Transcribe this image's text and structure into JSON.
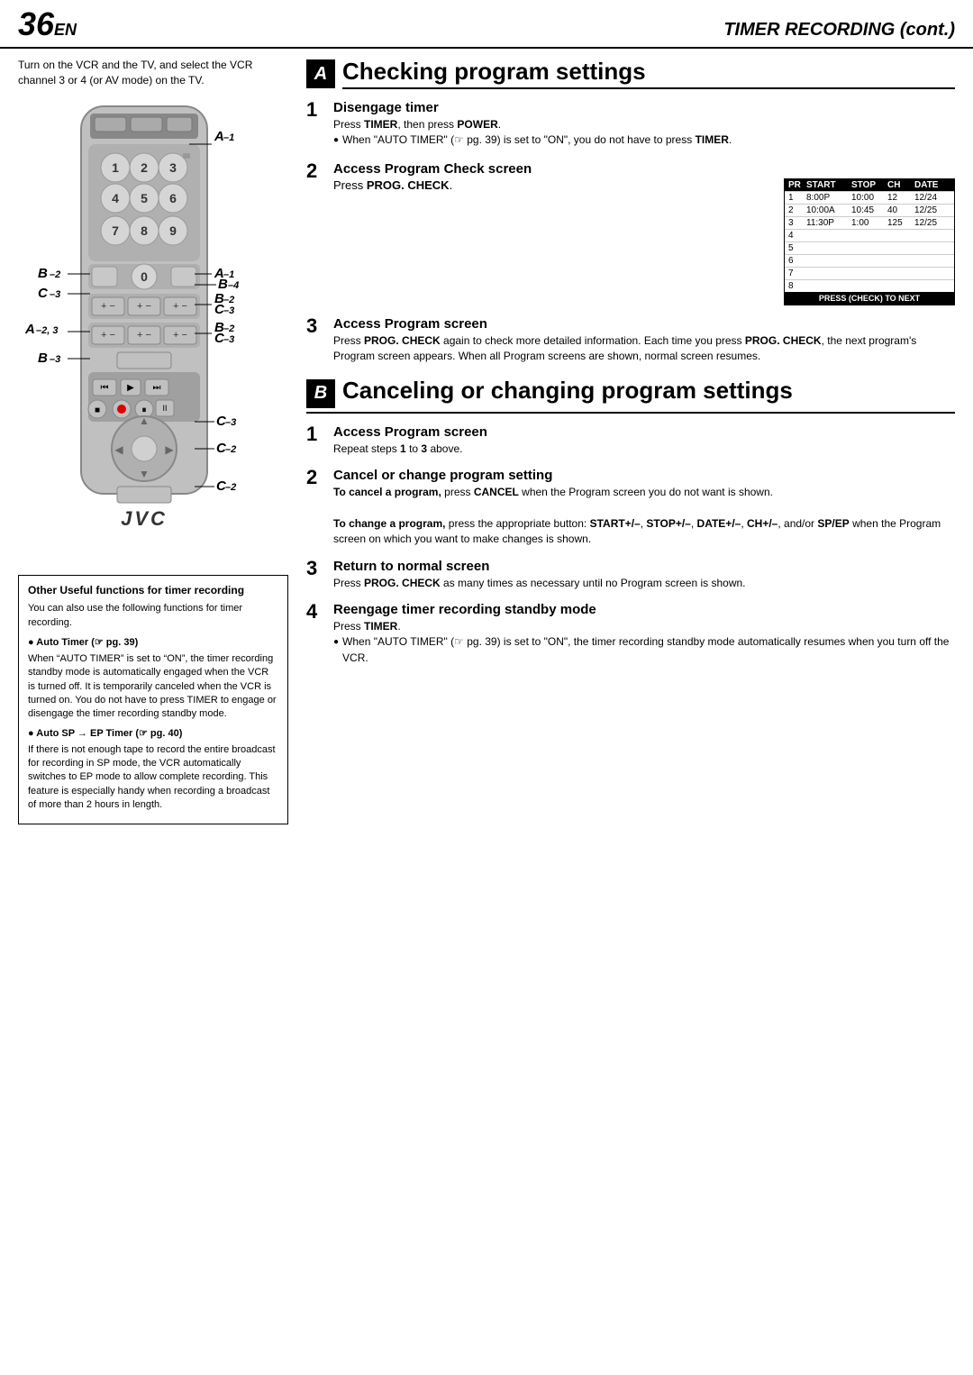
{
  "header": {
    "page_number": "36",
    "page_suffix": "EN",
    "page_title": "TIMER RECORDING (cont.)"
  },
  "intro": {
    "text": "Turn on the VCR and the TV, and select the VCR channel 3 or 4 (or AV mode) on the TV."
  },
  "section_a": {
    "badge": "A",
    "title": "Checking program settings",
    "steps": [
      {
        "num": "1",
        "title": "Disengage timer",
        "body": "Press TIMER, then press POWER.",
        "bullet": "When “AUTO TIMER” (→ pg. 39) is set to “ON”, you do not have to press TIMER."
      },
      {
        "num": "2",
        "title": "Access Program Check screen",
        "body": "Press PROG. CHECK.",
        "table": {
          "headers": [
            "PR",
            "START",
            "STOP",
            "CH",
            "DATE"
          ],
          "rows": [
            [
              "1",
              "8:00P",
              "10:00",
              "12",
              "12/24"
            ],
            [
              "2",
              "10:00A",
              "10:45",
              "40",
              "12/25"
            ],
            [
              "3",
              "11:30P",
              "1:00",
              "125",
              "12/25"
            ],
            [
              "4",
              "",
              "",
              "",
              ""
            ],
            [
              "5",
              "",
              "",
              "",
              ""
            ],
            [
              "6",
              "",
              "",
              "",
              ""
            ],
            [
              "7",
              "",
              "",
              "",
              ""
            ],
            [
              "8",
              "",
              "",
              "",
              ""
            ]
          ],
          "footer": "PRESS (CHECK) TO NEXT"
        }
      },
      {
        "num": "3",
        "title": "Access Program screen",
        "body": "Press PROG. CHECK again to check more detailed information. Each time you press PROG. CHECK, the next program’s Program screen appears. When all Program screens are shown, normal screen resumes."
      }
    ]
  },
  "section_b": {
    "badge": "B",
    "title": "Canceling or changing program settings",
    "steps": [
      {
        "num": "1",
        "title": "Access Program screen",
        "body": "Repeat steps 1 to 3 above."
      },
      {
        "num": "2",
        "title": "Cancel or change program setting",
        "cancel_text": "To cancel a program, press CANCEL when the Program screen you do not want is shown.",
        "change_text": "To change a program, press the appropriate button: START+/–, STOP+/–, DATE+/–, CH+/–, and/or SP/EP when the Program screen on which you want to make changes is shown."
      },
      {
        "num": "3",
        "title": "Return to normal screen",
        "body": "Press PROG. CHECK as many times as necessary until no Program screen is shown."
      },
      {
        "num": "4",
        "title": "Reengage timer recording standby mode",
        "body": "Press TIMER.",
        "bullet": "When “AUTO TIMER” (→ pg. 39) is set to “ON”, the timer recording standby mode automatically resumes when you turn off the VCR."
      }
    ]
  },
  "info_box": {
    "title": "Other Useful functions for timer recording",
    "intro": "You can also use the following functions for timer recording.",
    "items": [
      {
        "title": "● Auto Timer (☞ pg. 39)",
        "body": "When “AUTO TIMER” is set to “ON”, the timer recording standby mode is automatically engaged when the VCR is turned off. It is temporarily canceled when the VCR is turned on. You do not have to press TIMER to engage or disengage the timer recording standby mode."
      },
      {
        "title": "● Auto SP → EP Timer (☞ pg. 40)",
        "body": "If there is not enough tape to record the entire broadcast for recording in SP mode, the VCR automatically switches to EP mode to allow complete recording. This feature is especially handy when recording a broadcast of more than 2 hours in length."
      }
    ]
  },
  "remote": {
    "labels": [
      {
        "id": "A1_top",
        "text": "A",
        "sub": "–1"
      },
      {
        "id": "B2",
        "text": "B",
        "sub": "–2"
      },
      {
        "id": "C3",
        "text": "C",
        "sub": "–3"
      },
      {
        "id": "A23",
        "text": "A",
        "sub": "–2, 3"
      },
      {
        "id": "B3_left",
        "text": "B",
        "sub": "–3"
      },
      {
        "id": "A1_mid",
        "text": "A",
        "sub": "–1"
      },
      {
        "id": "B4",
        "text": "B",
        "sub": "–4"
      },
      {
        "id": "B2C3",
        "text": "B",
        "sub": "–2"
      },
      {
        "id": "C3_r",
        "text": "C",
        "sub": "–3"
      },
      {
        "id": "B2C3_2",
        "text": "B",
        "sub": "–2"
      },
      {
        "id": "C3_r2",
        "text": "C",
        "sub": "–3"
      },
      {
        "id": "C3_bot",
        "text": "C",
        "sub": "–3"
      },
      {
        "id": "C2_1",
        "text": "C",
        "sub": "–2"
      },
      {
        "id": "C2_2",
        "text": "C",
        "sub": "–2"
      }
    ],
    "jvc_logo": "JVC"
  }
}
